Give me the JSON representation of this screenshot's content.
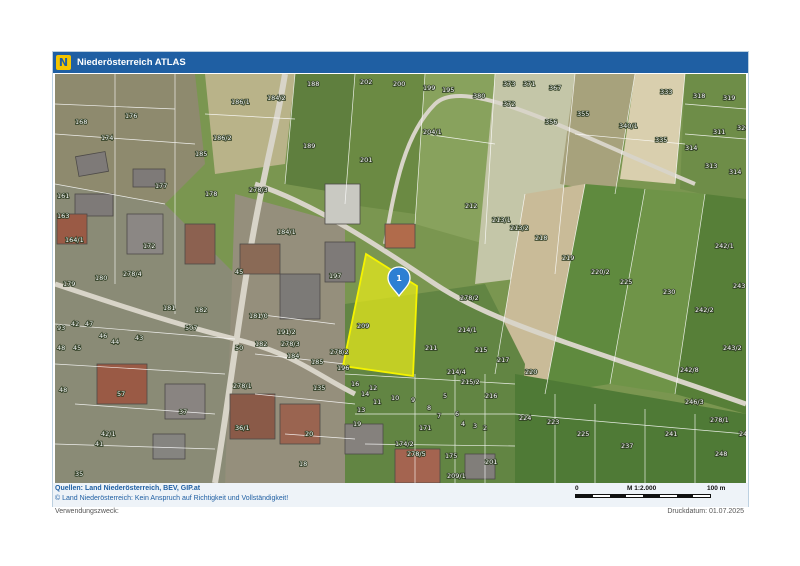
{
  "header": {
    "logo_glyph": "N",
    "title": "Niederösterreich ATLAS",
    "brand_color": "#1f5fa3",
    "logo_color": "#f3c500"
  },
  "map": {
    "marker": {
      "label": "1",
      "color": "#2d7fd3"
    },
    "highlight_color": "#e8ea1a",
    "highlight_parcel": "209",
    "parcel_labels": [
      "168",
      "176",
      "186/1",
      "184/2",
      "188",
      "202",
      "200",
      "199",
      "195",
      "380",
      "373",
      "371",
      "372",
      "367",
      "356",
      "355",
      "340/1",
      "333",
      "318",
      "319",
      "320",
      "311",
      "314",
      "313",
      "314",
      "174",
      "177",
      "185",
      "186/2",
      "189",
      "201",
      "204/1",
      "212",
      "213/1",
      "213/2",
      "218",
      "219",
      "220/2",
      "225",
      "230",
      "242/1",
      "242/2",
      "243",
      "243/2",
      "242/8",
      "246/3",
      "246/3",
      "278/1",
      "248",
      "237",
      "242/0",
      "241",
      "161",
      "163",
      "164/1",
      "172",
      "178",
      "179",
      "180",
      "181",
      "182",
      "278/4",
      "278/3",
      "45",
      "196",
      "197",
      "278/2",
      "209",
      "214/1",
      "215",
      "211",
      "214/4",
      "215/2",
      "216",
      "217",
      "220",
      "224",
      "223",
      "225",
      "93",
      "42",
      "43",
      "47",
      "46",
      "48",
      "45",
      "44",
      "43",
      "48",
      "50",
      "61",
      "507",
      "182",
      "191/2",
      "278/3",
      "184",
      "185",
      "135",
      "16",
      "14",
      "13",
      "12",
      "11",
      "10",
      "9",
      "8",
      "7",
      "6",
      "5",
      "4",
      "3",
      "2",
      "278/1",
      "19",
      "37",
      "36/1",
      "42/1",
      "20",
      "57",
      "35",
      "18",
      "171",
      "174/2",
      "278/5",
      "175",
      "201",
      "41",
      "209/1"
    ],
    "scale_ratio": "M 1:2.000",
    "scale_start": "0",
    "scale_end": "100 m"
  },
  "footer": {
    "sources": "Quellen: Land Niederösterreich, BEV, GIP.at",
    "disclaimer": "© Land Niederösterreich: Kein Anspruch auf Richtigkeit und Vollständigkeit!"
  },
  "below": {
    "purpose_label": "Verwendungszweck:",
    "print_date": "Druckdatum: 01.07.2025"
  }
}
